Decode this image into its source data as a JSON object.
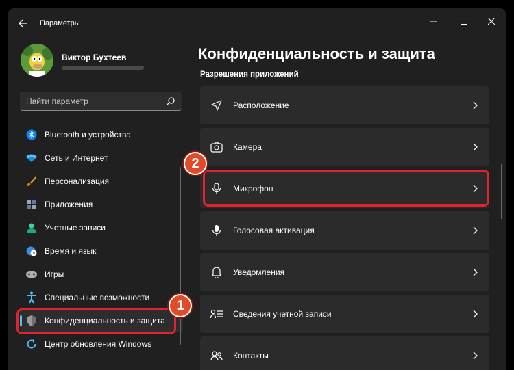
{
  "window": {
    "title": "Параметры"
  },
  "user": {
    "name": "Виктор Бухтеев"
  },
  "search": {
    "placeholder": "Найти параметр"
  },
  "sidebar": {
    "items": [
      {
        "label": "Bluetooth и устройства",
        "icon": "bluetooth-icon"
      },
      {
        "label": "Сеть и Интернет",
        "icon": "wifi-icon"
      },
      {
        "label": "Персонализация",
        "icon": "brush-icon"
      },
      {
        "label": "Приложения",
        "icon": "apps-icon"
      },
      {
        "label": "Учетные записи",
        "icon": "person-icon"
      },
      {
        "label": "Время и язык",
        "icon": "globe-clock-icon"
      },
      {
        "label": "Игры",
        "icon": "gamepad-icon"
      },
      {
        "label": "Специальные возможности",
        "icon": "accessibility-icon"
      },
      {
        "label": "Конфиденциальность и защита",
        "icon": "shield-icon",
        "active": true
      },
      {
        "label": "Центр обновления Windows",
        "icon": "update-icon"
      }
    ]
  },
  "main": {
    "title": "Конфиденциальность и защита",
    "section": "Разрешения приложений",
    "rows": [
      {
        "label": "Расположение",
        "icon": "location-icon"
      },
      {
        "label": "Камера",
        "icon": "camera-icon"
      },
      {
        "label": "Микрофон",
        "icon": "microphone-icon"
      },
      {
        "label": "Голосовая активация",
        "icon": "voice-icon"
      },
      {
        "label": "Уведомления",
        "icon": "bell-icon"
      },
      {
        "label": "Сведения учетной записи",
        "icon": "account-info-icon"
      },
      {
        "label": "Контакты",
        "icon": "contacts-icon"
      }
    ]
  },
  "annotations": {
    "step1": "1",
    "step2": "2"
  },
  "colors": {
    "background": "#202020",
    "card": "#2b2b2b",
    "accent": "#4cc2ff",
    "highlight": "#e0232c"
  }
}
